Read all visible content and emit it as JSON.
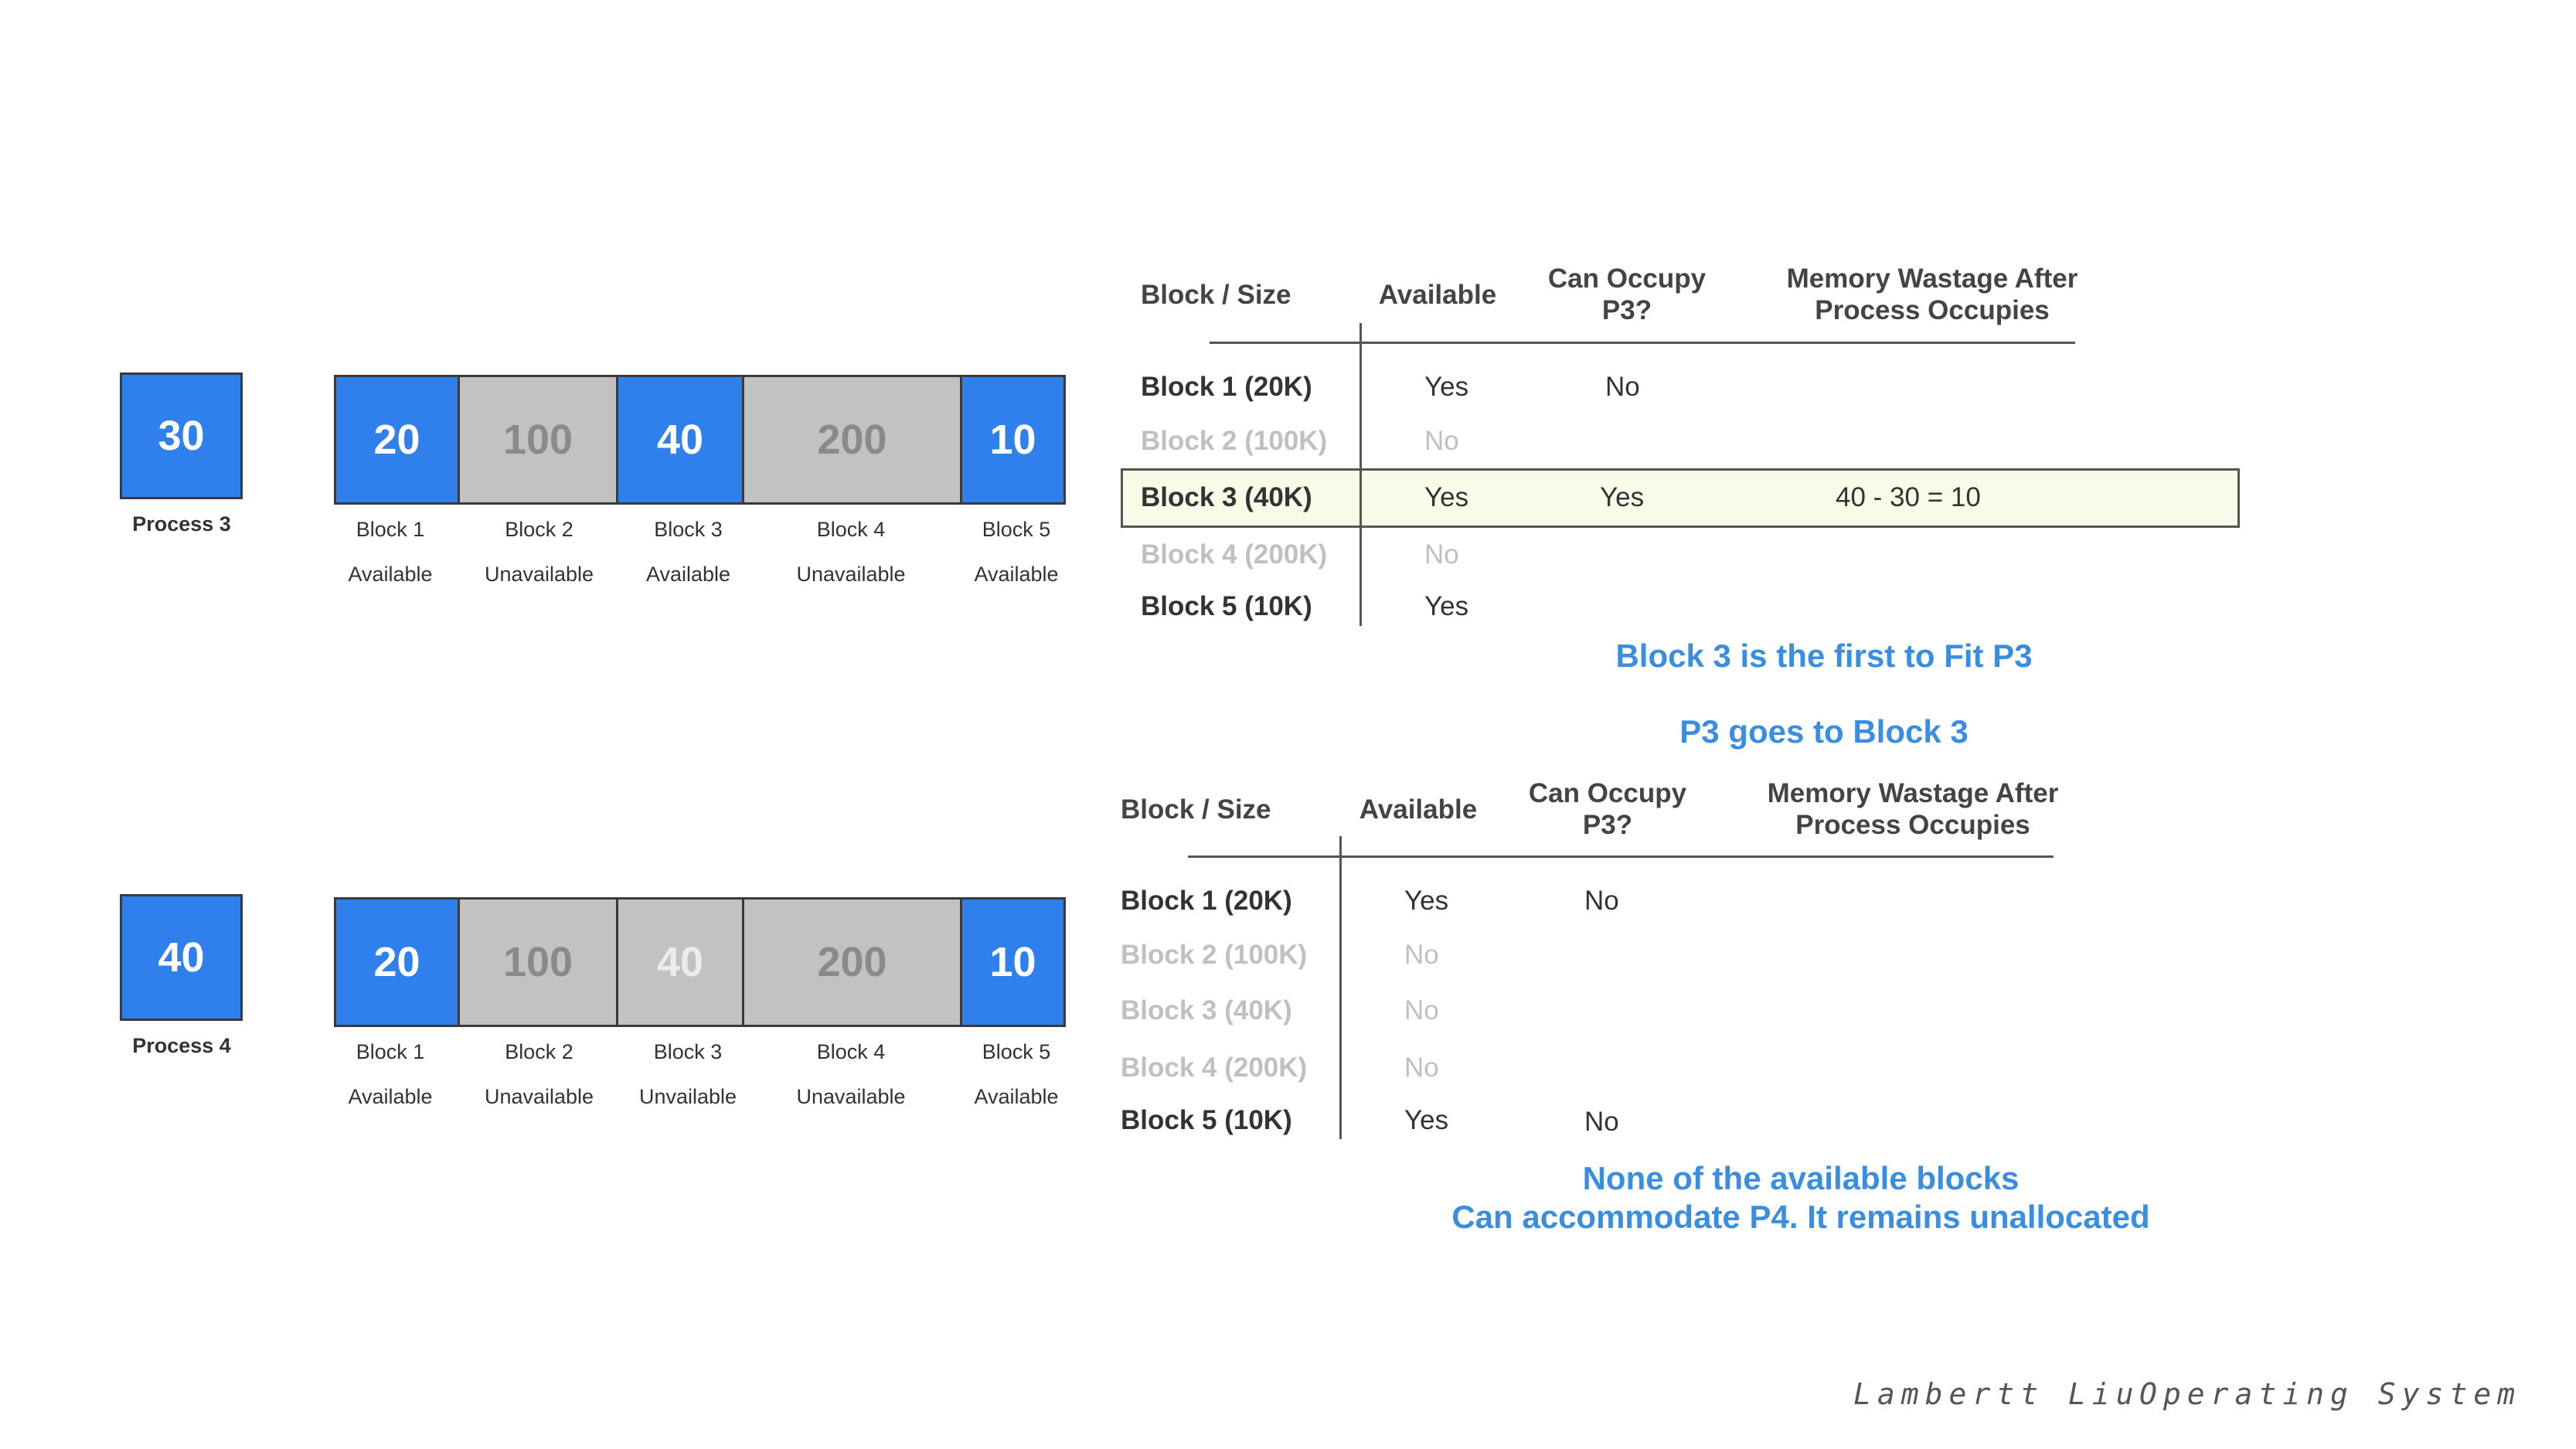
{
  "top": {
    "process": {
      "value": "30",
      "label": "Process 3"
    },
    "blocks": [
      {
        "value": "20",
        "name": "Block 1",
        "status": "Available"
      },
      {
        "value": "100",
        "name": "Block 2",
        "status": "Unavailable"
      },
      {
        "value": "40",
        "name": "Block 3",
        "status": "Available"
      },
      {
        "value": "200",
        "name": "Block 4",
        "status": "Unavailable"
      },
      {
        "value": "10",
        "name": "Block 5",
        "status": "Available"
      }
    ],
    "table": {
      "headers": {
        "block_size": "Block / Size",
        "available": "Available",
        "can_occupy": "Can Occupy P3?",
        "wastage": "Memory Wastage After Process Occupies"
      },
      "rows": [
        {
          "block": "Block 1 (20K)",
          "available": "Yes",
          "can_occupy": "No",
          "wastage": ""
        },
        {
          "block": "Block 2 (100K)",
          "available": "No",
          "can_occupy": "",
          "wastage": ""
        },
        {
          "block": "Block 3 (40K)",
          "available": "Yes",
          "can_occupy": "Yes",
          "wastage": "40 - 30 = 10"
        },
        {
          "block": "Block 4 (200K)",
          "available": "No",
          "can_occupy": "",
          "wastage": ""
        },
        {
          "block": "Block 5 (10K)",
          "available": "Yes",
          "can_occupy": "",
          "wastage": ""
        }
      ]
    },
    "note1": "Block 3 is the first to Fit P3",
    "note2": "P3 goes to Block 3"
  },
  "bottom": {
    "process": {
      "value": "40",
      "label": "Process 4"
    },
    "blocks": [
      {
        "value": "20",
        "name": "Block 1",
        "status": "Available"
      },
      {
        "value": "100",
        "name": "Block 2",
        "status": "Unavailable"
      },
      {
        "value": "40",
        "name": "Block 3",
        "status": "Unvailable"
      },
      {
        "value": "200",
        "name": "Block 4",
        "status": "Unavailable"
      },
      {
        "value": "10",
        "name": "Block 5",
        "status": "Available"
      }
    ],
    "table": {
      "headers": {
        "block_size": "Block / Size",
        "available": "Available",
        "can_occupy": "Can Occupy P3?",
        "wastage": "Memory Wastage After Process Occupies"
      },
      "rows": [
        {
          "block": "Block 1 (20K)",
          "available": "Yes",
          "can_occupy": "No"
        },
        {
          "block": "Block 2 (100K)",
          "available": "No",
          "can_occupy": ""
        },
        {
          "block": "Block 3 (40K)",
          "available": "No",
          "can_occupy": ""
        },
        {
          "block": "Block 4 (200K)",
          "available": "No",
          "can_occupy": ""
        },
        {
          "block": "Block 5 (10K)",
          "available": "Yes",
          "can_occupy": "No"
        }
      ]
    },
    "note_line1": "None of the available blocks",
    "note_line2": "Can accommodate P4. It remains unallocated"
  },
  "footer": {
    "author": "Lambertt Liu",
    "course": "Operating System"
  },
  "colors": {
    "available": "#2f80ed",
    "unavailable": "#c2c2c2",
    "note": "#3a8ee0",
    "highlight": "#fafae8"
  }
}
